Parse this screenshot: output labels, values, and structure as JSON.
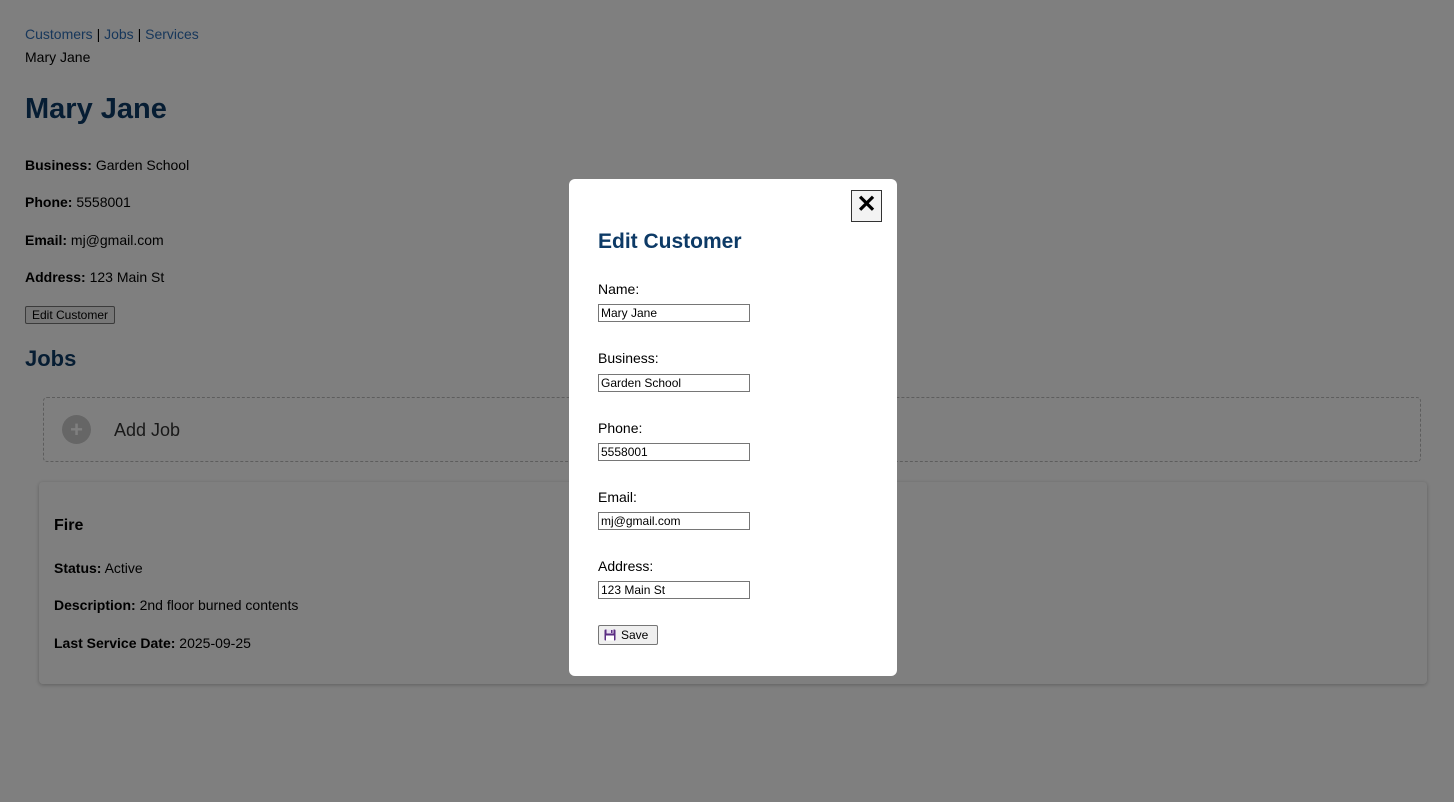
{
  "nav": {
    "links": [
      "Customers",
      "Jobs",
      "Services"
    ],
    "separator": "|",
    "breadcrumb": "Mary Jane"
  },
  "customer": {
    "name": "Mary Jane",
    "fields": [
      {
        "label": "Business:",
        "value": "Garden School"
      },
      {
        "label": "Phone:",
        "value": "5558001"
      },
      {
        "label": "Email:",
        "value": "mj@gmail.com"
      },
      {
        "label": "Address:",
        "value": "123 Main St"
      }
    ],
    "edit_button": "Edit Customer"
  },
  "jobs": {
    "heading": "Jobs",
    "add_label": "Add Job",
    "add_icon": "plus-icon",
    "items": [
      {
        "title": "Fire",
        "rows": [
          {
            "label": "Status:",
            "value": "Active"
          },
          {
            "label": "Description:",
            "value": "2nd floor burned contents"
          },
          {
            "label": "Last Service Date:",
            "value": "2025-09-25"
          }
        ]
      }
    ]
  },
  "modal": {
    "title": "Edit Customer",
    "close_symbol": "✕",
    "fields": [
      {
        "label": "Name:",
        "value": "Mary Jane"
      },
      {
        "label": "Business:",
        "value": "Garden School"
      },
      {
        "label": "Phone:",
        "value": "5558001"
      },
      {
        "label": "Email:",
        "value": "mj@gmail.com"
      },
      {
        "label": "Address:",
        "value": "123 Main St"
      }
    ],
    "save_label": "Save",
    "save_icon": "floppy-disk-icon"
  },
  "colors": {
    "link": "#2f6fb6",
    "heading": "#0d3a66",
    "overlay": "rgba(0,0,0,0.5)"
  }
}
